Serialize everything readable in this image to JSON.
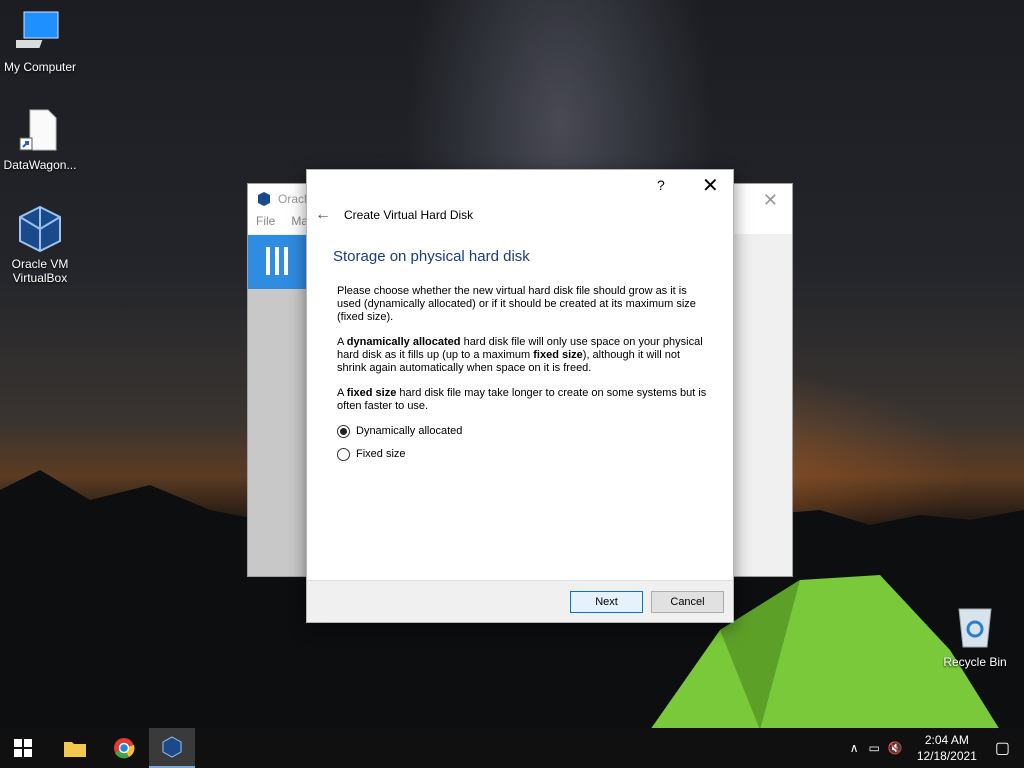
{
  "desktop": {
    "icons": [
      {
        "label": "My Computer",
        "icon": "computer-icon"
      },
      {
        "label": "DataWagon...",
        "icon": "file-shortcut-icon"
      },
      {
        "label": "Oracle VM VirtualBox",
        "icon": "virtualbox-icon"
      },
      {
        "label": "Recycle Bin",
        "icon": "recycle-bin-icon"
      }
    ]
  },
  "bg_window": {
    "title": "Oracle",
    "menu": [
      "File",
      "Ma"
    ]
  },
  "dialog": {
    "help": "?",
    "close": "✕",
    "back": "←",
    "title": "Create Virtual Hard Disk",
    "heading": "Storage on physical hard disk",
    "para1": "Please choose whether the new virtual hard disk file should grow as it is used (dynamically allocated) or if it should be created at its maximum size (fixed size).",
    "para2_a": "A ",
    "para2_b": "dynamically allocated",
    "para2_c": " hard disk file will only use space on your physical hard disk as it fills up (up to a maximum ",
    "para2_d": "fixed size",
    "para2_e": "), although it will not shrink again automatically when space on it is freed.",
    "para3_a": "A ",
    "para3_b": "fixed size",
    "para3_c": " hard disk file may take longer to create on some systems but is often faster to use.",
    "options": [
      {
        "label": "Dynamically allocated",
        "selected": true
      },
      {
        "label": "Fixed size",
        "selected": false
      }
    ],
    "next_label": "Next",
    "cancel_label": "Cancel"
  },
  "taskbar": {
    "time": "2:04 AM",
    "date": "12/18/2021"
  },
  "colors": {
    "accent": "#0078d7",
    "heading": "#1c3d7a",
    "toolbar_blue": "#2f8ce0"
  }
}
